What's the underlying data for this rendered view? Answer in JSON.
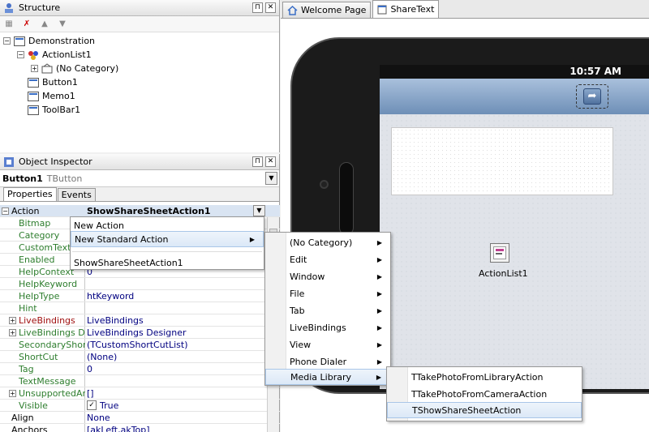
{
  "structure": {
    "title": "Structure",
    "tree": [
      {
        "label": "Demonstration",
        "icon": "form-icon"
      },
      {
        "label": "ActionList1",
        "icon": "actionlist-icon"
      },
      {
        "label": "(No Category)",
        "icon": "category-icon"
      },
      {
        "label": "Button1",
        "icon": "component-icon"
      },
      {
        "label": "Memo1",
        "icon": "component-icon"
      },
      {
        "label": "ToolBar1",
        "icon": "component-icon"
      }
    ]
  },
  "object_inspector": {
    "title": "Object Inspector",
    "selected_component": "Button1",
    "selected_type": "TButton",
    "tabs": [
      "Properties",
      "Events"
    ],
    "properties": [
      {
        "name": "Action",
        "value": "ShowShareSheetAction1"
      },
      {
        "name": "Bitmap",
        "value": ""
      },
      {
        "name": "Category",
        "value": ""
      },
      {
        "name": "CustomText",
        "value": ""
      },
      {
        "name": "Enabled",
        "value": ""
      },
      {
        "name": "HelpContext",
        "value": "0"
      },
      {
        "name": "HelpKeyword",
        "value": ""
      },
      {
        "name": "HelpType",
        "value": "htKeyword"
      },
      {
        "name": "Hint",
        "value": ""
      },
      {
        "name": "LiveBindings",
        "value": "LiveBindings"
      },
      {
        "name": "LiveBindings Designer",
        "value": "LiveBindings Designer"
      },
      {
        "name": "SecondaryShortCuts",
        "value": "(TCustomShortCutList)"
      },
      {
        "name": "ShortCut",
        "value": "(None)"
      },
      {
        "name": "Tag",
        "value": "0"
      },
      {
        "name": "TextMessage",
        "value": ""
      },
      {
        "name": "UnsupportedArchitectures",
        "value": "[]"
      },
      {
        "name": "Visible",
        "value": "True"
      },
      {
        "name": "Align",
        "value": "None"
      },
      {
        "name": "Anchors",
        "value": "[akLeft,akTop]"
      }
    ]
  },
  "doc_tabs": [
    "Welcome Page",
    "ShareText"
  ],
  "device": {
    "time": "10:57 AM",
    "component_label": "ActionList1"
  },
  "action_menu": {
    "items": [
      "New Action",
      "New Standard Action",
      "ShowShareSheetAction1"
    ]
  },
  "category_menu": {
    "items": [
      "(No Category)",
      "Edit",
      "Window",
      "File",
      "Tab",
      "LiveBindings",
      "View",
      "Phone Dialer",
      "Media Library"
    ]
  },
  "media_menu": {
    "items": [
      "TTakePhotoFromLibraryAction",
      "TTakePhotoFromCameraAction",
      "TShowShareSheetAction"
    ]
  }
}
